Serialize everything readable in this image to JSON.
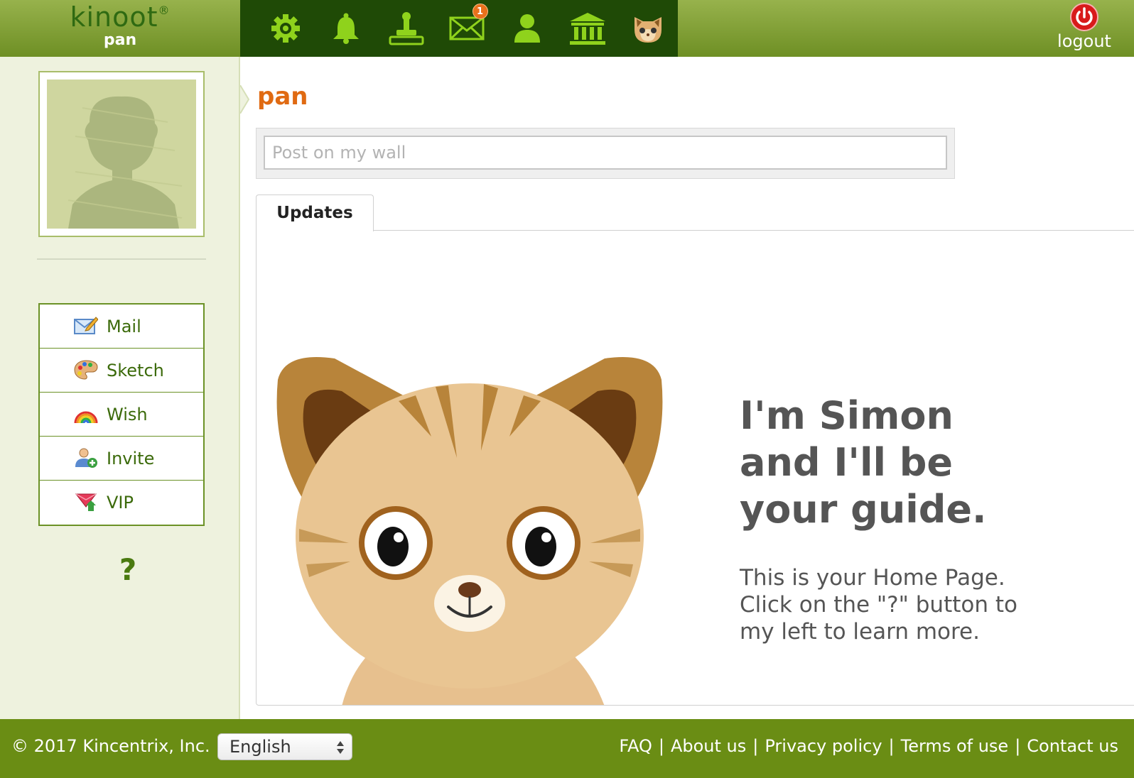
{
  "brand": {
    "logo": "kinoot",
    "trademark": "®",
    "username": "pan"
  },
  "nav_icons": [
    {
      "name": "settings-gear-icon"
    },
    {
      "name": "notifications-bell-icon"
    },
    {
      "name": "stamp-icon"
    },
    {
      "name": "mail-envelope-icon",
      "badge": "1"
    },
    {
      "name": "profile-person-icon"
    },
    {
      "name": "bank-building-icon"
    },
    {
      "name": "kitten-guide-icon"
    }
  ],
  "logout": {
    "label": "logout"
  },
  "sidebar": {
    "menu": [
      {
        "label": "Mail",
        "icon": "mail-pencil-icon"
      },
      {
        "label": "Sketch",
        "icon": "palette-icon"
      },
      {
        "label": "Wish",
        "icon": "rainbow-icon"
      },
      {
        "label": "Invite",
        "icon": "invite-person-icon"
      },
      {
        "label": "VIP",
        "icon": "vip-gem-icon"
      }
    ],
    "help": "?"
  },
  "main": {
    "title": "pan",
    "post_placeholder": "Post on my wall",
    "tab": "Updates",
    "guide_heading": "I'm Simon and I'll be your guide.",
    "guide_text": "This is your Home Page. Click on the \"?\" button to my left to learn more."
  },
  "footer": {
    "copyright": "© 2017 Kincentrix, Inc.",
    "language": "English",
    "links": [
      "FAQ",
      "About us",
      "Privacy policy",
      "Terms of use",
      "Contact us"
    ]
  },
  "colors": {
    "topbar": "#7e9c30",
    "iconbar": "#1f4a06",
    "accent_orange": "#e06a12",
    "footer": "#6a8d14",
    "sidebar": "#eef2de"
  }
}
